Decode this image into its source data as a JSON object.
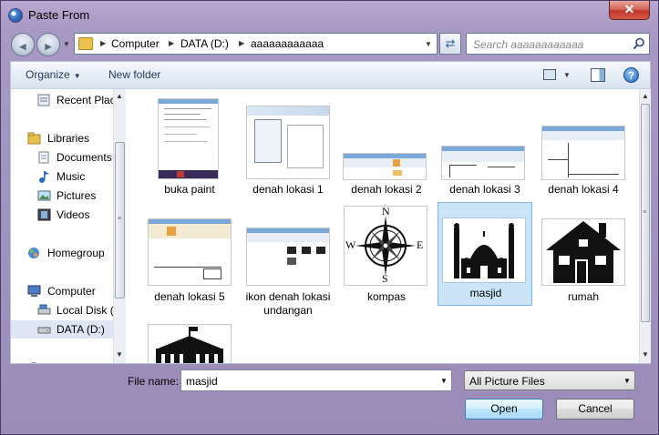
{
  "window": {
    "title": "Paste From",
    "close_glyph": "✕"
  },
  "nav": {
    "back_glyph": "◀",
    "forward_glyph": "▶",
    "breadcrumbs": [
      "Computer",
      "DATA (D:)",
      "aaaaaaaaaaaa"
    ],
    "search_placeholder": "Search aaaaaaaaaaaa"
  },
  "toolbar": {
    "organize": "Organize",
    "new_folder": "New folder",
    "help_glyph": "?"
  },
  "sidebar": {
    "items": [
      {
        "label": "Recent Places",
        "icon": "recent-places-icon"
      },
      {
        "label": "Libraries",
        "icon": "libraries-icon"
      },
      {
        "label": "Documents",
        "icon": "documents-icon"
      },
      {
        "label": "Music",
        "icon": "music-icon"
      },
      {
        "label": "Pictures",
        "icon": "pictures-icon"
      },
      {
        "label": "Videos",
        "icon": "videos-icon"
      },
      {
        "label": "Homegroup",
        "icon": "homegroup-icon"
      },
      {
        "label": "Computer",
        "icon": "computer-icon"
      },
      {
        "label": "Local Disk (C:)",
        "icon": "drive-icon"
      },
      {
        "label": "DATA (D:)",
        "icon": "drive-icon",
        "selected": true
      }
    ]
  },
  "files": [
    {
      "name": "buka paint"
    },
    {
      "name": "denah lokasi 1"
    },
    {
      "name": "denah lokasi 2"
    },
    {
      "name": "denah lokasi 3"
    },
    {
      "name": "denah lokasi 4"
    },
    {
      "name": "denah lokasi 5"
    },
    {
      "name": "ikon denah lokasi undangan"
    },
    {
      "name": "kompas",
      "compass_letters": [
        "N",
        "E",
        "S",
        "W"
      ]
    },
    {
      "name": "masjid",
      "selected": true
    },
    {
      "name": "rumah"
    }
  ],
  "bottom": {
    "file_name_label": "File name:",
    "file_name_value": "masjid",
    "filter_value": "All Picture Files",
    "open_label": "Open",
    "cancel_label": "Cancel"
  },
  "colors": {
    "selection": "#cce4f7",
    "selection_border": "#7eb4ea",
    "title_bg": "#a898c4"
  }
}
